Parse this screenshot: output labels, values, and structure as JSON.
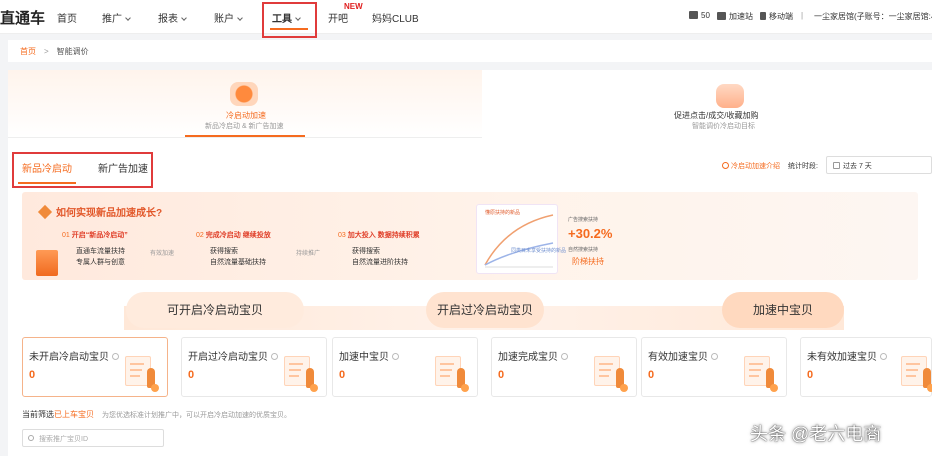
{
  "topnav": {
    "brand": "直通车",
    "items": [
      {
        "label": "首页",
        "dropdown": false
      },
      {
        "label": "推广",
        "dropdown": true
      },
      {
        "label": "报表",
        "dropdown": true
      },
      {
        "label": "账户",
        "dropdown": true
      },
      {
        "label": "工具",
        "dropdown": true
      },
      {
        "label": "开吧",
        "dropdown": false
      },
      {
        "label": "妈妈CLUB",
        "dropdown": false
      }
    ],
    "new_badge": "NEW",
    "right": {
      "msg_count": "50",
      "academy": "加速站",
      "mobile": "移动端",
      "separator": "|",
      "account": "一尘家居馆(子账号：一尘家居馆:小..."
    }
  },
  "breadcrumb": {
    "home": "首页",
    "current": "智能调价"
  },
  "features": {
    "left": {
      "title": "冷启动加速",
      "sub": "新品冷启动 & 新广告加速"
    },
    "right": {
      "title": "促进点击/成交/收藏加购",
      "sub": "智能调价冷启动目标"
    }
  },
  "tabs": [
    {
      "label": "新品冷启动",
      "active": true
    },
    {
      "label": "新广告加速",
      "active": false
    }
  ],
  "toolbar": {
    "intro_link": "冷启动加速介绍",
    "period_label": "统计时段:",
    "period_value": "过去 7 天"
  },
  "banner": {
    "question": "如何实现新品加速成长?",
    "steps": [
      {
        "num": "01",
        "prefix": "开启",
        "highlight": "“新品冷启动”",
        "lines": [
          "直通车流量扶持",
          "专属人群与创意"
        ]
      },
      {
        "num": "02",
        "prefix": "完成冷启动  ",
        "highlight": "继续投放",
        "lines": [
          "获得搜索",
          "自然流量基础扶持"
        ]
      },
      {
        "num": "03",
        "prefix": "加大投入  ",
        "highlight": "数据持续积累",
        "lines": [
          "获得搜索",
          "自然流量进阶扶持"
        ]
      }
    ],
    "connectors": [
      "有效加速",
      "持续推广"
    ],
    "mini_chart": {
      "series_top": "懂原扶持的新品",
      "series_bottom": "同类目未享受扶持的新品"
    },
    "stat_label": "广告搜索扶持",
    "stat_value": "+30.2%",
    "stat_label2": "自然搜索扶持",
    "stair_text": "阶梯扶持"
  },
  "pipeline": [
    "可开启冷启动宝贝",
    "开启过冷启动宝贝",
    "加速中宝贝"
  ],
  "cards": [
    {
      "title": "未开启冷启动宝贝",
      "value": "0",
      "active": true
    },
    {
      "title": "开启过冷启动宝贝",
      "value": "0",
      "active": false
    },
    {
      "title": "加速中宝贝",
      "value": "0",
      "active": false
    },
    {
      "title": "加速完成宝贝",
      "value": "0",
      "active": false
    },
    {
      "title": "有效加速宝贝",
      "value": "0",
      "active": false
    },
    {
      "title": "未有效加速宝贝",
      "value": "0",
      "active": false
    }
  ],
  "filter": {
    "prefix": "当前筛选",
    "highlight": "已上车宝贝",
    "note": "为您优选标准计划推广中，可以开启冷启动加速的优质宝贝。"
  },
  "search": {
    "placeholder": "搜索推广宝贝ID"
  },
  "watermark": "头条 @老六电商",
  "colors": {
    "accent": "#f56b1f",
    "highlight_box": "#e03b3b"
  }
}
